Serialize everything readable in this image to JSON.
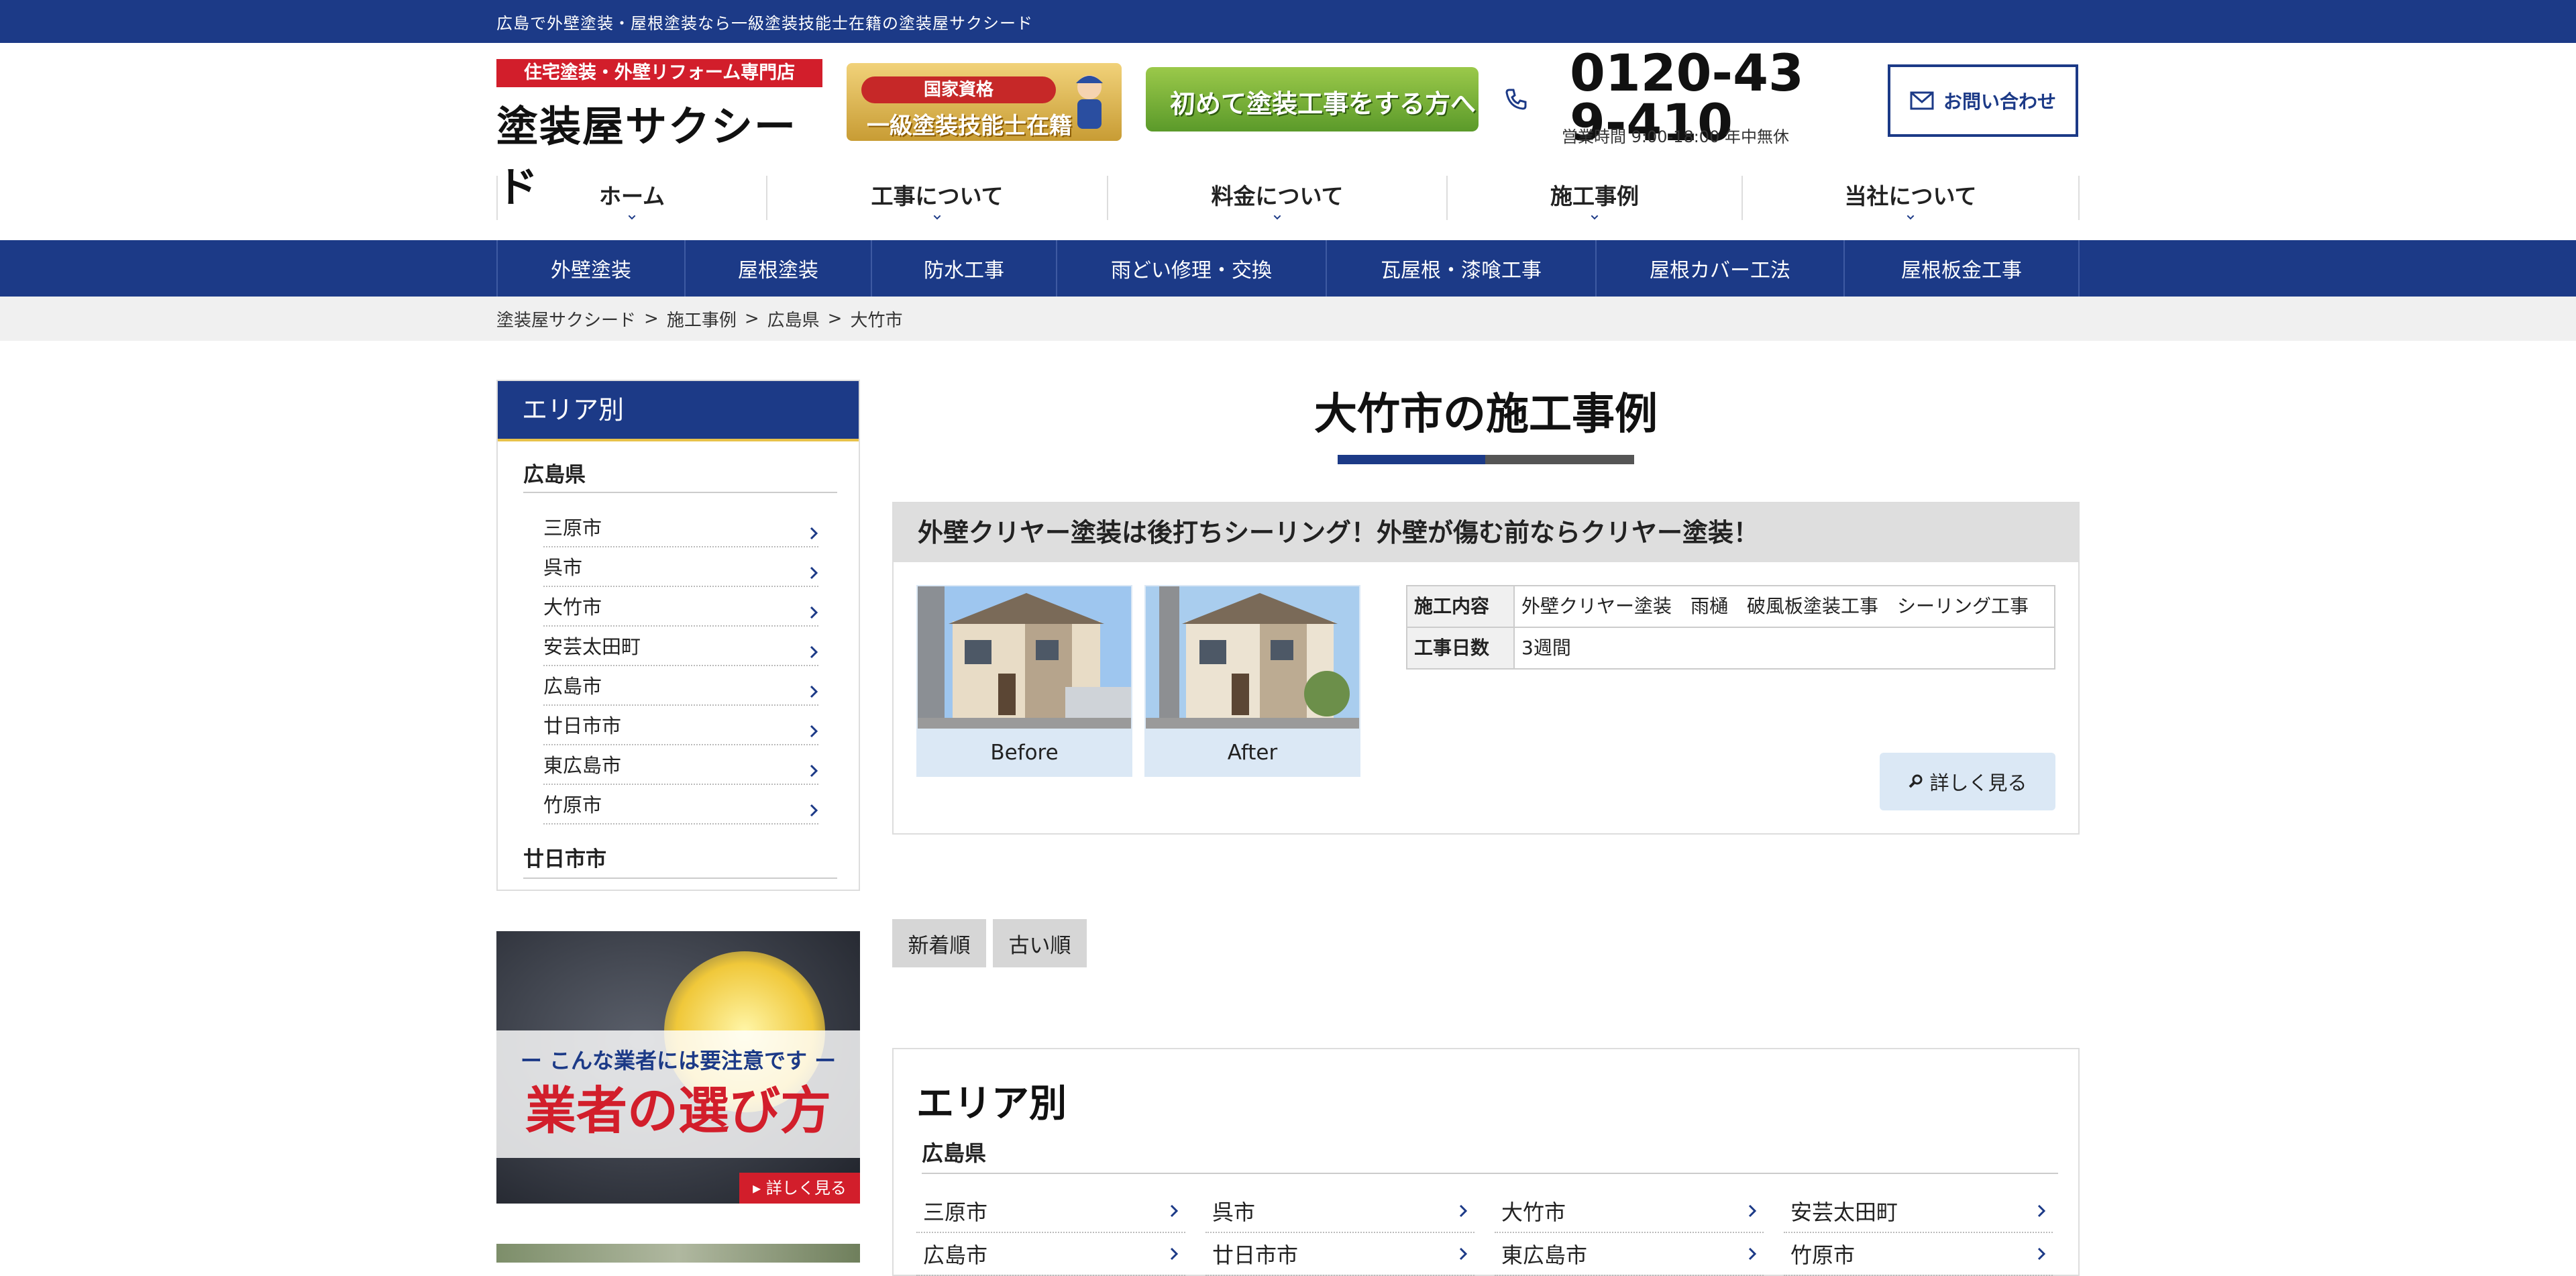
{
  "topbar": {
    "tagline": "広島で外壁塗装・屋根塗装なら一級塗装技能士在籍の塗装屋サクシード"
  },
  "header": {
    "logo_tag": "住宅塗装・外壁リフォーム専門店",
    "logo_name": "塗装屋サクシード",
    "badge_qualification_top": "国家資格",
    "badge_qualification": "一級塗装技能士在籍",
    "badge_first_time": "初めて塗装工事をする方へ",
    "phone": "0120-439-410",
    "hours": "営業時間 9:00-18:00 年中無休",
    "contact_label": "お問い合わせ"
  },
  "main_nav": [
    {
      "label": "ホーム"
    },
    {
      "label": "工事について"
    },
    {
      "label": "料金について"
    },
    {
      "label": "施工事例"
    },
    {
      "label": "当社について"
    }
  ],
  "sub_nav": [
    {
      "label": "外壁塗装"
    },
    {
      "label": "屋根塗装"
    },
    {
      "label": "防水工事"
    },
    {
      "label": "雨どい修理・交換"
    },
    {
      "label": "瓦屋根・漆喰工事"
    },
    {
      "label": "屋根カバー工法"
    },
    {
      "label": "屋根板金工事"
    }
  ],
  "breadcrumb": [
    "塗装屋サクシード",
    "施工事例",
    "広島県",
    "大竹市"
  ],
  "sidebar": {
    "heading": "エリア別",
    "prefecture": "広島県",
    "cities": [
      "三原市",
      "呉市",
      "大竹市",
      "安芸太田町",
      "広島市",
      "廿日市市",
      "東広島市",
      "竹原市"
    ],
    "next_group": "廿日市市",
    "banner1_line1": "ー こんな業者には要注意です ー",
    "banner1_line2": "業者の選び方",
    "banner1_more": "▸ 詳しく見る"
  },
  "main": {
    "page_title": "大竹市の施工事例",
    "case": {
      "title": "外壁クリヤー塗装は後打ちシーリング！外壁が傷む前ならクリヤー塗装！",
      "before_label": "Before",
      "after_label": "After",
      "work_label": "施工内容",
      "work_value": "外壁クリヤー塗装　雨樋　破風板塗装工事　シーリング工事",
      "days_label": "工事日数",
      "days_value": "3週間",
      "detail_button": "詳しく見る"
    },
    "sort": {
      "newest": "新着順",
      "oldest": "古い順"
    },
    "area": {
      "heading": "エリア別",
      "prefecture": "広島県",
      "cities": [
        "三原市",
        "呉市",
        "大竹市",
        "安芸太田町",
        "広島市",
        "廿日市市",
        "東広島市",
        "竹原市"
      ]
    }
  },
  "colors": {
    "brand_navy": "#1c3a87",
    "accent_red": "#d21e2b",
    "accent_gold": "#e8c24a"
  }
}
